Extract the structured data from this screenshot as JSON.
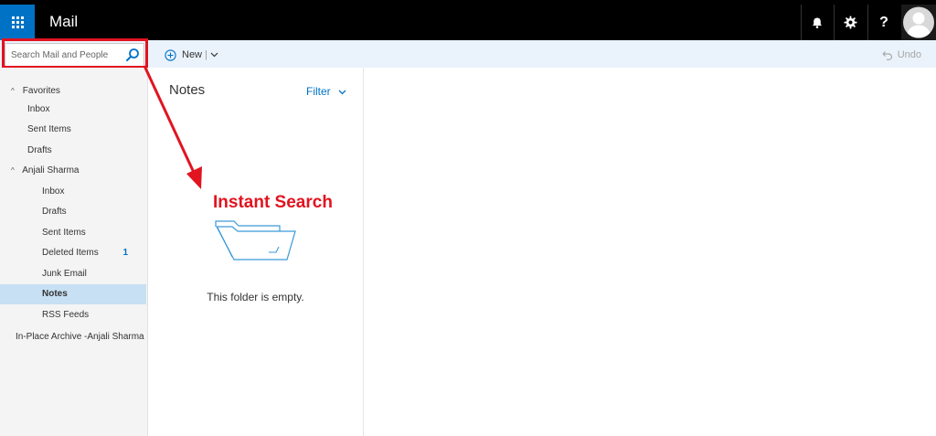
{
  "app": {
    "title": "Mail"
  },
  "search": {
    "placeholder": "Search Mail and People"
  },
  "commands": {
    "new_label": "New",
    "undo_label": "Undo"
  },
  "sidebar": {
    "favorites_label": "Favorites",
    "favorites": [
      {
        "label": "Inbox"
      },
      {
        "label": "Sent Items"
      },
      {
        "label": "Drafts"
      }
    ],
    "account_label": "Anjali Sharma",
    "folders": [
      {
        "label": "Inbox"
      },
      {
        "label": "Drafts"
      },
      {
        "label": "Sent Items"
      },
      {
        "label": "Deleted Items",
        "count": "1"
      },
      {
        "label": "Junk Email"
      },
      {
        "label": "Notes"
      },
      {
        "label": "RSS Feeds"
      }
    ],
    "selected": "Notes",
    "archive_label": "In-Place Archive -Anjali Sharma"
  },
  "list": {
    "title": "Notes",
    "filter_label": "Filter",
    "empty_text": "This folder is empty."
  },
  "annotation": {
    "text": "Instant Search",
    "color": "#e1141f"
  },
  "colors": {
    "accent": "#0072c6",
    "selected": "#c7e0f4",
    "topbar": "#000000",
    "commandbar": "#eaf3fb"
  }
}
